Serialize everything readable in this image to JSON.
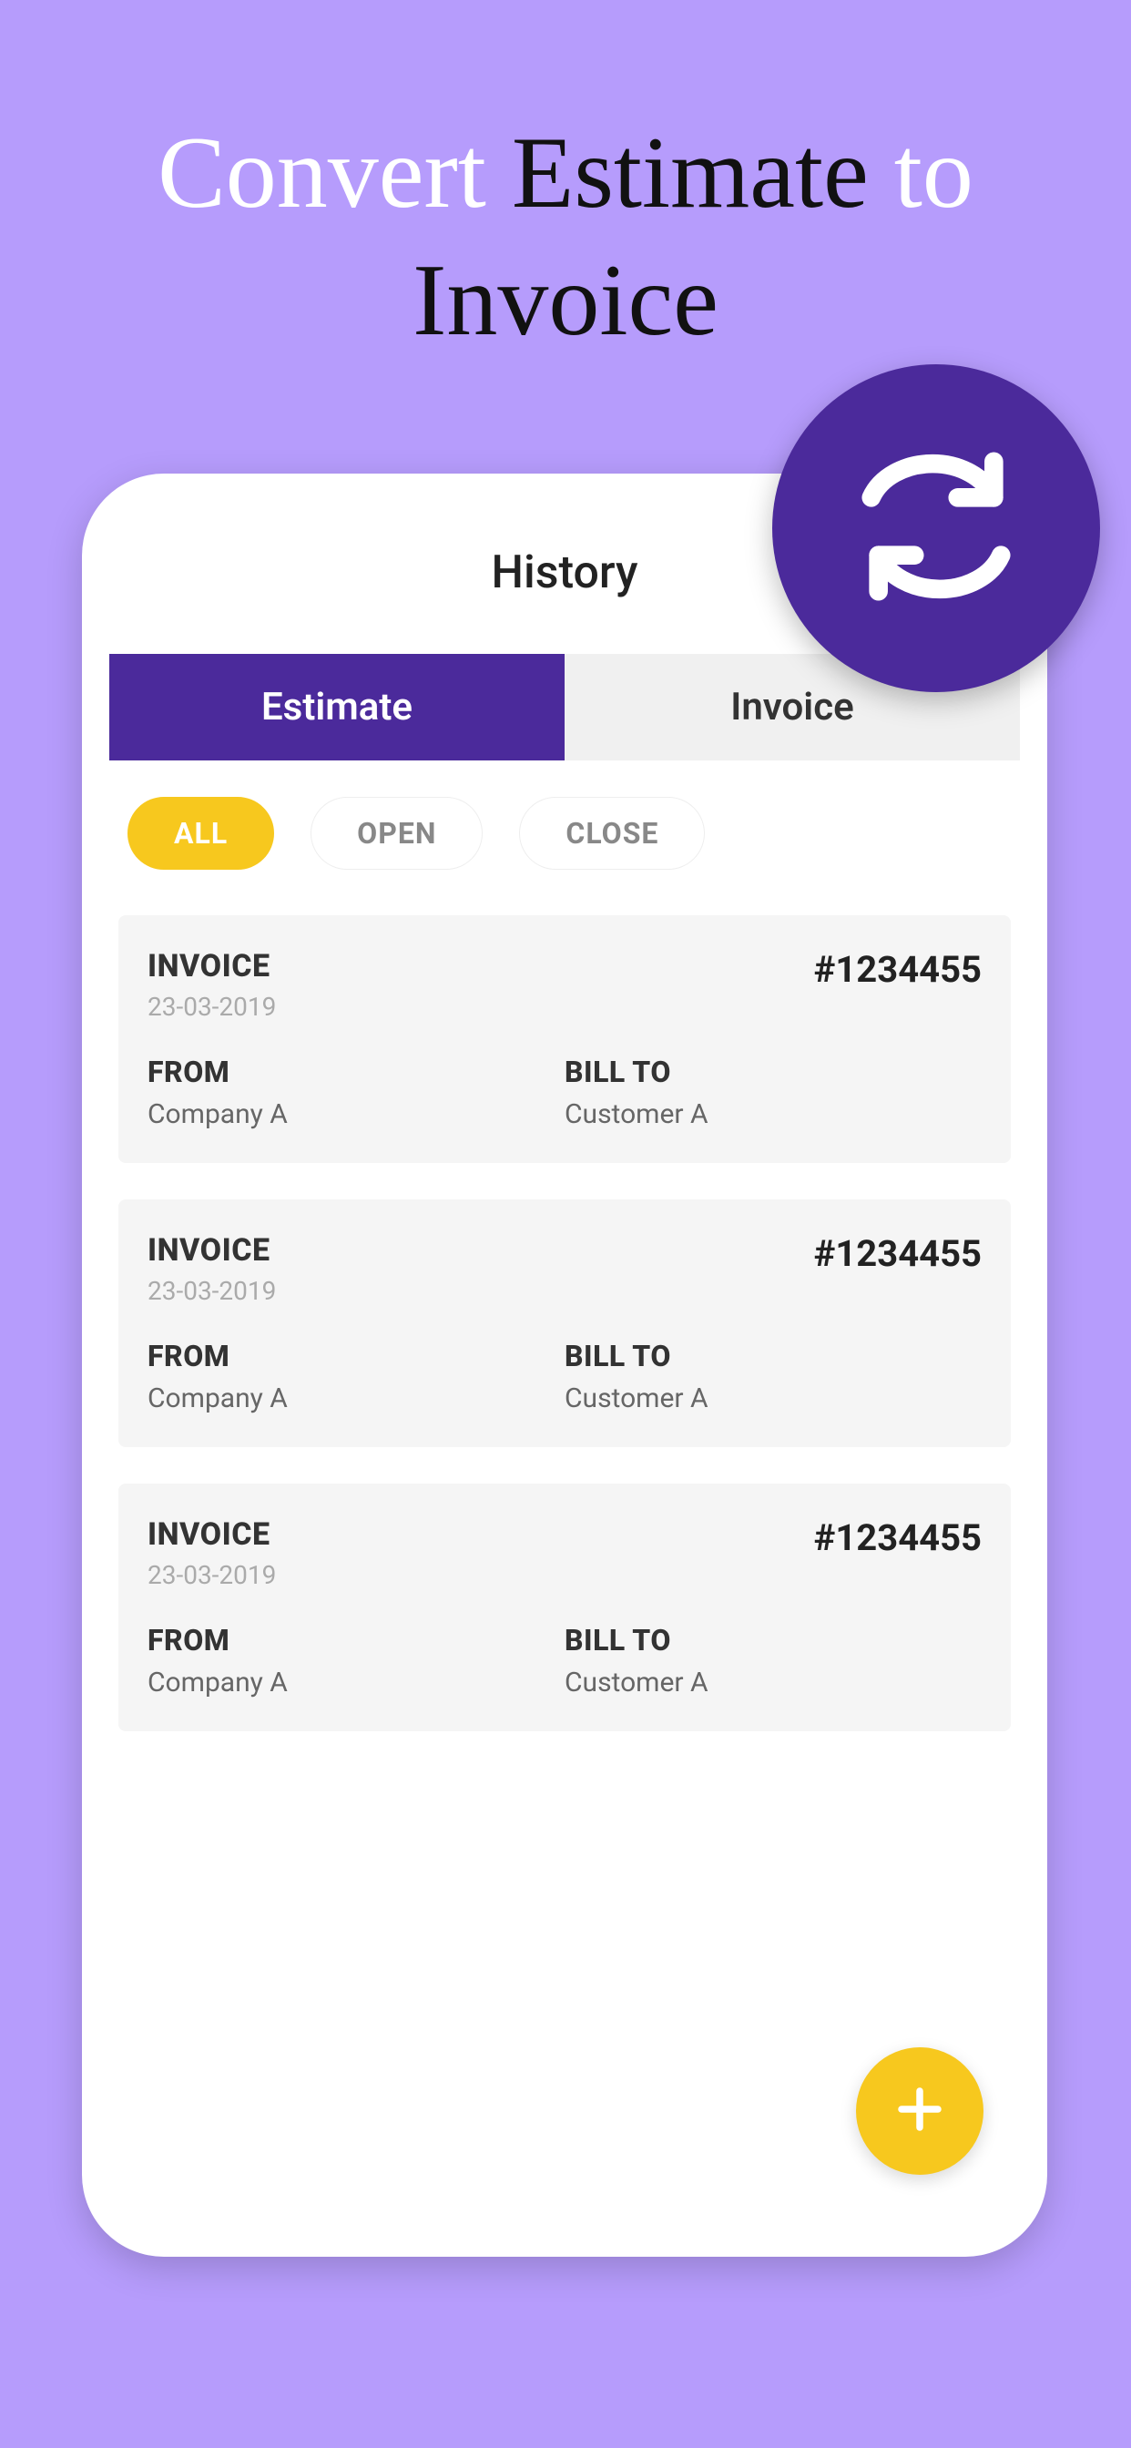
{
  "hero": {
    "w1": "Convert",
    "w2": "Estimate",
    "w3": "to",
    "w4": "Invoice"
  },
  "screen": {
    "title": "History",
    "tabs": {
      "estimate": "Estimate",
      "invoice": "Invoice",
      "active": "estimate"
    },
    "filters": {
      "all": "ALL",
      "open": "OPEN",
      "close": "CLOSE",
      "active": "all"
    },
    "labels": {
      "from": "FROM",
      "bill_to": "BILL TO"
    },
    "cards": [
      {
        "type": "INVOICE",
        "date": "23-03-2019",
        "number": "#1234455",
        "from": "Company A",
        "bill_to": "Customer A"
      },
      {
        "type": "INVOICE",
        "date": "23-03-2019",
        "number": "#1234455",
        "from": "Company A",
        "bill_to": "Customer A"
      },
      {
        "type": "INVOICE",
        "date": "23-03-2019",
        "number": "#1234455",
        "from": "Company A",
        "bill_to": "Customer A"
      }
    ]
  }
}
